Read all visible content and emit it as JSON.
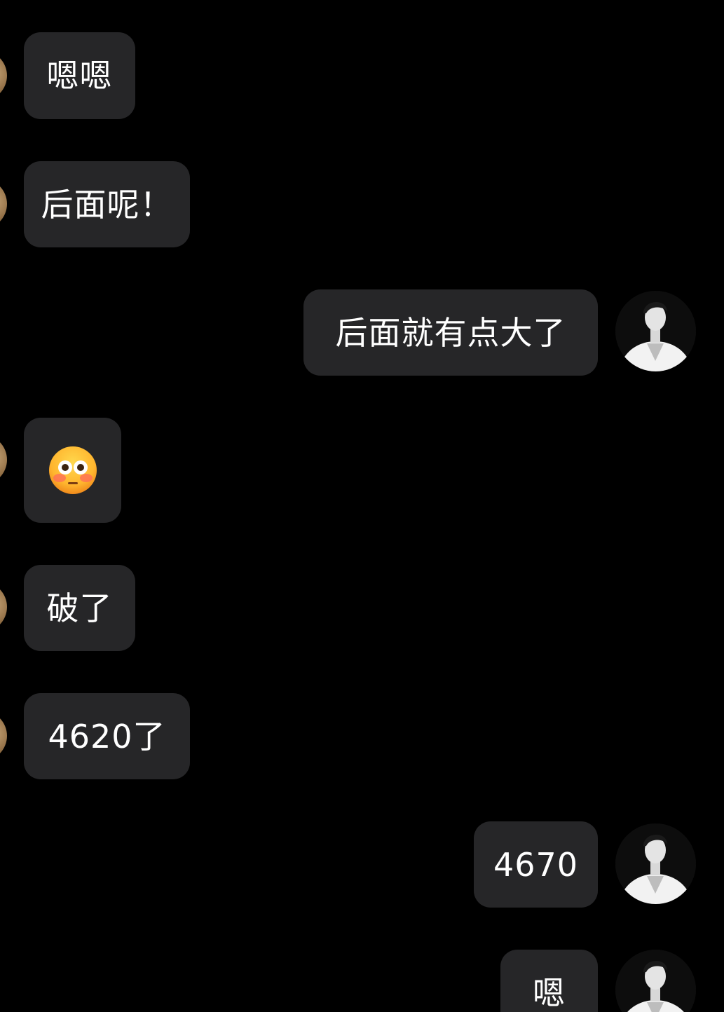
{
  "conversation": {
    "messages": [
      {
        "sender": "contact",
        "text": "嗯嗯"
      },
      {
        "sender": "contact",
        "text": "后面呢！"
      },
      {
        "sender": "me",
        "text": "后面就有点大了"
      },
      {
        "sender": "contact",
        "emoji": "flushed-face-emoji"
      },
      {
        "sender": "contact",
        "text": "破了"
      },
      {
        "sender": "contact",
        "text": "4620了"
      },
      {
        "sender": "me",
        "text": "4670"
      },
      {
        "sender": "me",
        "text": "嗯"
      }
    ]
  },
  "colors": {
    "background": "#000000",
    "bubble": "#262628",
    "text": "#ffffff"
  }
}
